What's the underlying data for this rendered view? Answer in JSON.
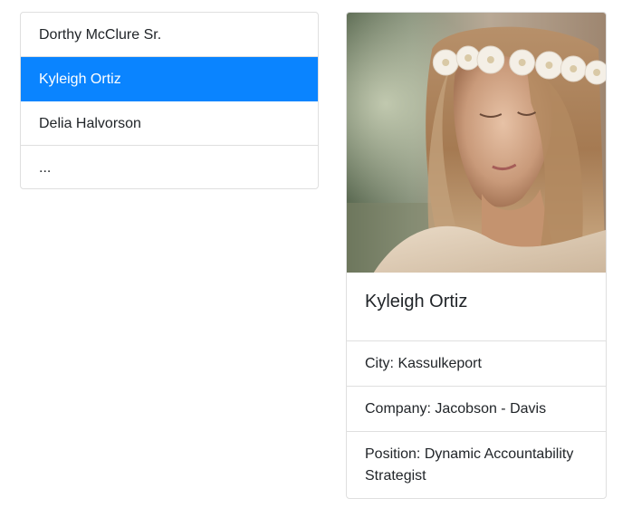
{
  "list": {
    "items": [
      {
        "label": "Dorthy McClure Sr.",
        "active": false
      },
      {
        "label": "Kyleigh Ortiz",
        "active": true
      },
      {
        "label": "Delia Halvorson",
        "active": false
      },
      {
        "label": "...",
        "active": false
      }
    ]
  },
  "card": {
    "photo_alt": "",
    "name": "Kyleigh Ortiz",
    "city": "City: Kassulkeport",
    "company": "Company: Jacobson - Davis",
    "position": "Position: Dynamic Accountability Strategist"
  },
  "colors": {
    "active_bg": "#0a84ff",
    "border": "#dfdfdf",
    "text": "#212529"
  }
}
